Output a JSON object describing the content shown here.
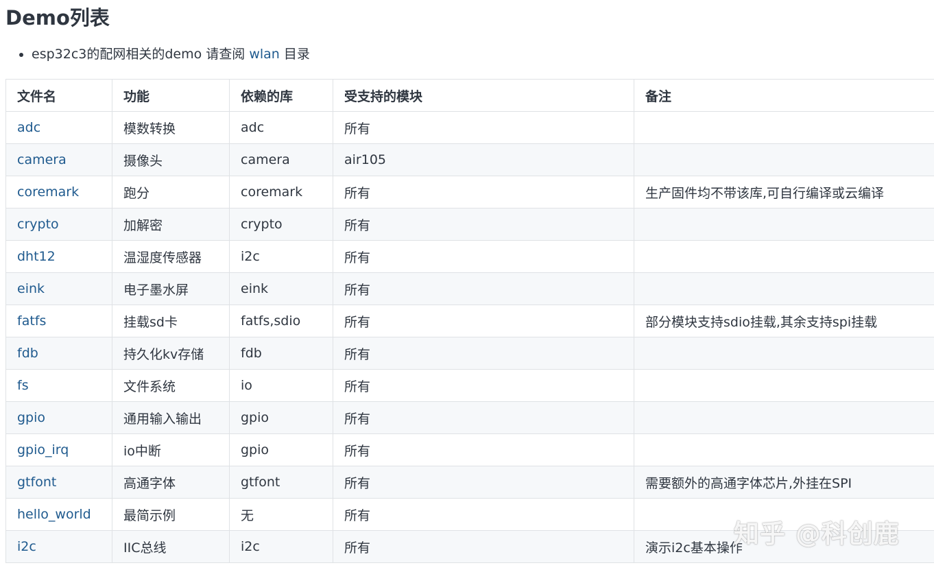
{
  "heading": "Demo列表",
  "note": {
    "prefix": "esp32c3的配网相关的demo 请查阅 ",
    "link": "wlan",
    "suffix": " 目录"
  },
  "table": {
    "headers": [
      "文件名",
      "功能",
      "依赖的库",
      "受支持的模块",
      "备注"
    ],
    "rows": [
      [
        "adc",
        "模数转换",
        "adc",
        "所有",
        ""
      ],
      [
        "camera",
        "摄像头",
        "camera",
        "air105",
        ""
      ],
      [
        "coremark",
        "跑分",
        "coremark",
        "所有",
        "生产固件均不带该库,可自行编译或云编译"
      ],
      [
        "crypto",
        "加解密",
        "crypto",
        "所有",
        ""
      ],
      [
        "dht12",
        "温湿度传感器",
        "i2c",
        "所有",
        ""
      ],
      [
        "eink",
        "电子墨水屏",
        "eink",
        "所有",
        ""
      ],
      [
        "fatfs",
        "挂载sd卡",
        "fatfs,sdio",
        "所有",
        "部分模块支持sdio挂载,其余支持spi挂载"
      ],
      [
        "fdb",
        "持久化kv存储",
        "fdb",
        "所有",
        ""
      ],
      [
        "fs",
        "文件系统",
        "io",
        "所有",
        ""
      ],
      [
        "gpio",
        "通用输入输出",
        "gpio",
        "所有",
        ""
      ],
      [
        "gpio_irq",
        "io中断",
        "gpio",
        "所有",
        ""
      ],
      [
        "gtfont",
        "高通字体",
        "gtfont",
        "所有",
        "需要额外的高通字体芯片,外挂在SPI"
      ],
      [
        "hello_world",
        "最简示例",
        "无",
        "所有",
        ""
      ],
      [
        "i2c",
        "IIC总线",
        "i2c",
        "所有",
        "演示i2c基本操作"
      ]
    ]
  },
  "watermark": "知乎 @科创鹿",
  "colors": {
    "link": "#1f5a8e",
    "text": "#2f3640",
    "border": "#dfe2e5",
    "stripe": "#f6f8fa"
  }
}
